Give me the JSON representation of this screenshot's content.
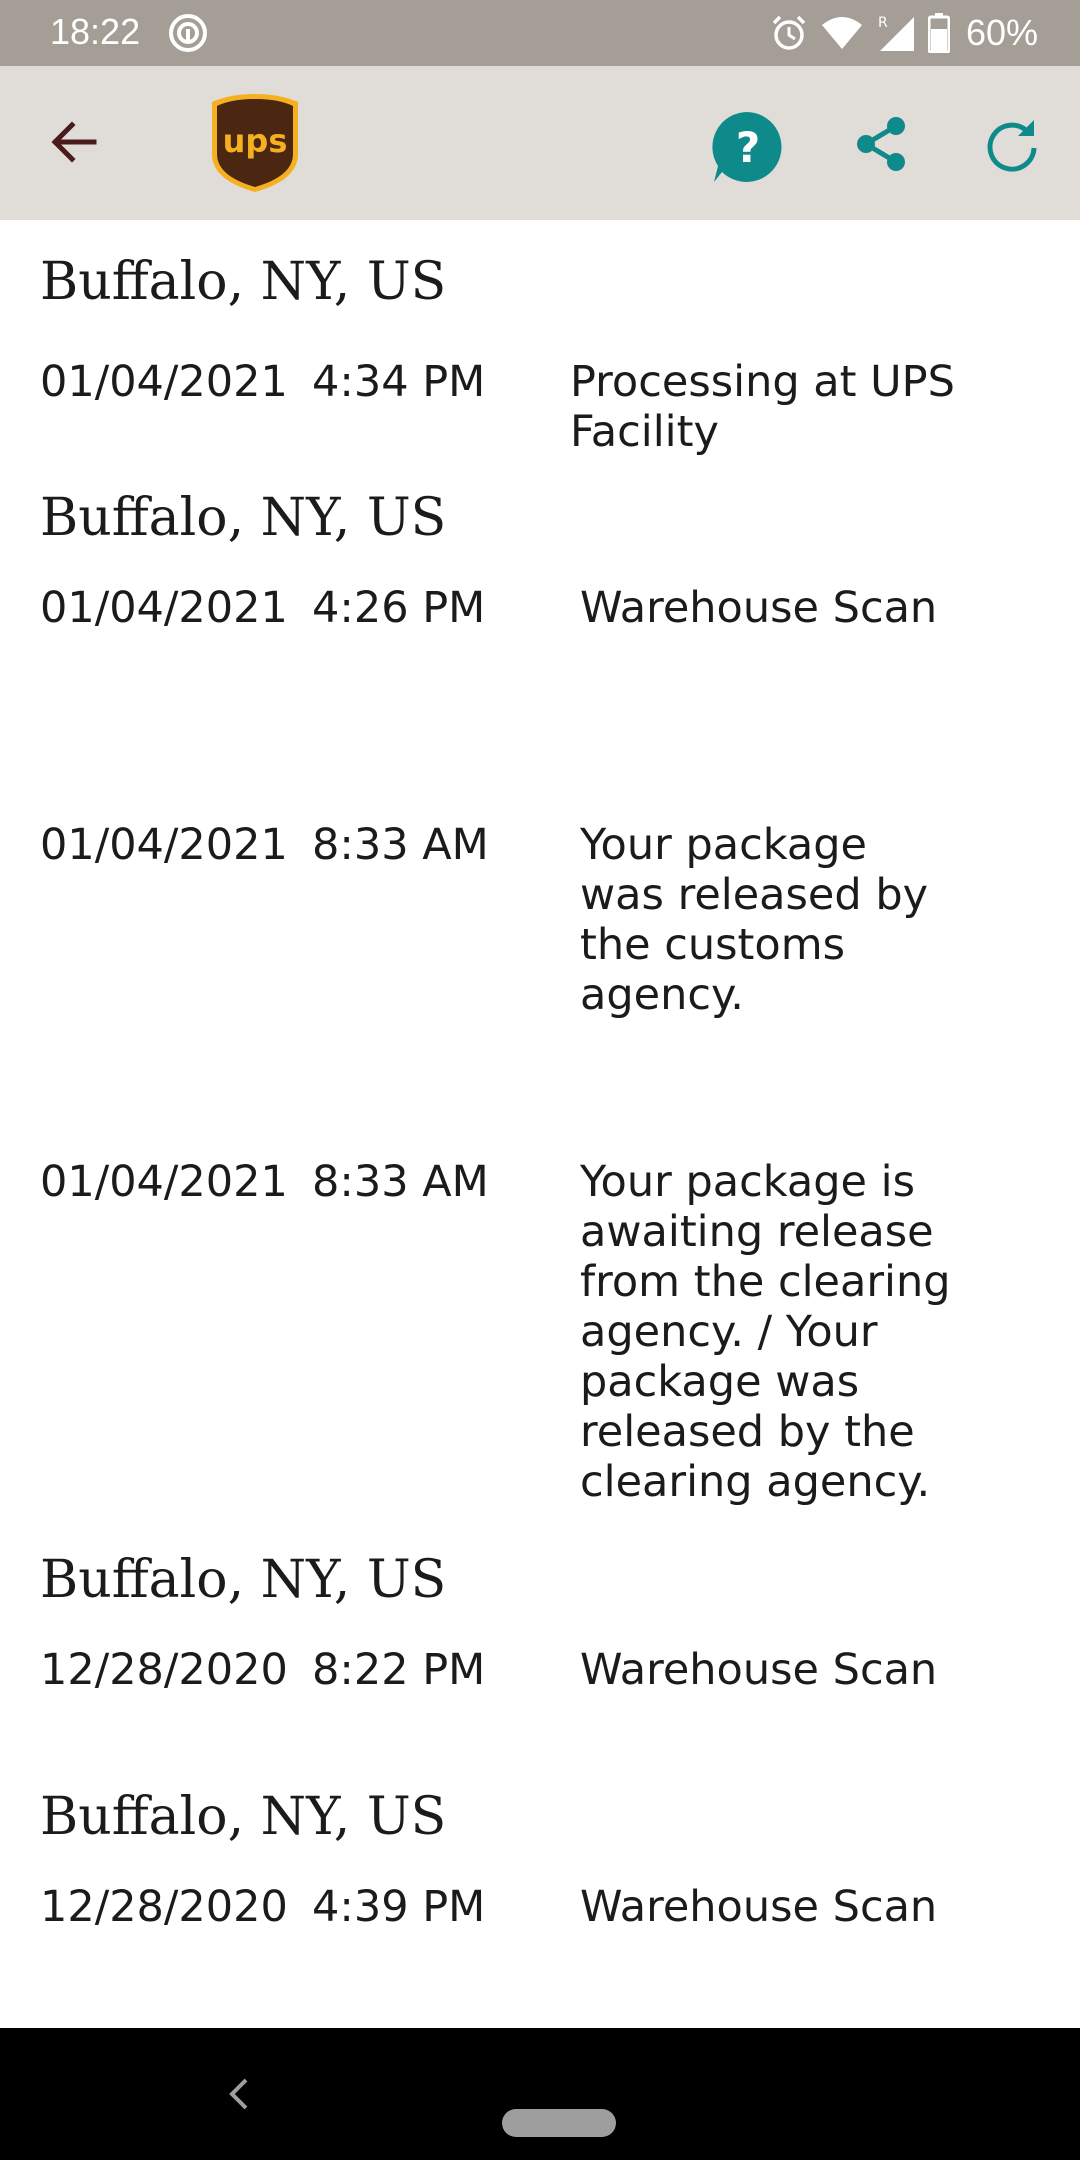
{
  "status_bar": {
    "time": "18:22",
    "battery": "60%",
    "icons": [
      "sync-icon",
      "alarm-icon",
      "wifi-icon",
      "signal-icon",
      "battery-icon"
    ]
  },
  "app_bar": {
    "logo_text": "ups",
    "icons": [
      "back-arrow-icon",
      "ups-logo",
      "help-icon",
      "share-icon",
      "refresh-icon"
    ],
    "colors": {
      "accent": "#0f8a8a",
      "brand_brown": "#4b2712",
      "brand_gold": "#f5b01f",
      "back": "#4b1b1b"
    }
  },
  "events": [
    {
      "location": "Buffalo, NY, US",
      "date": "01/04/2021",
      "time": "4:34 PM",
      "description": "Processing at UPS Facility"
    },
    {
      "location": "Buffalo, NY, US",
      "date": "01/04/2021",
      "time": "4:26 PM",
      "description": "Warehouse Scan"
    },
    {
      "location": "",
      "date": "01/04/2021",
      "time": "8:33 AM",
      "description": "Your package was released by the customs agency."
    },
    {
      "location": "",
      "date": "01/04/2021",
      "time": "8:33 AM",
      "description": "Your package is awaiting release from the clearing agency. / Your package was released by the clearing agency."
    },
    {
      "location": "Buffalo, NY, US",
      "date": "12/28/2020",
      "time": "8:22 PM",
      "description": "Warehouse Scan"
    },
    {
      "location": "Buffalo, NY, US",
      "date": "12/28/2020",
      "time": "4:39 PM",
      "description": "Warehouse Scan"
    }
  ],
  "nav_bar": {
    "icons": [
      "nav-back-icon",
      "home-pill"
    ]
  }
}
